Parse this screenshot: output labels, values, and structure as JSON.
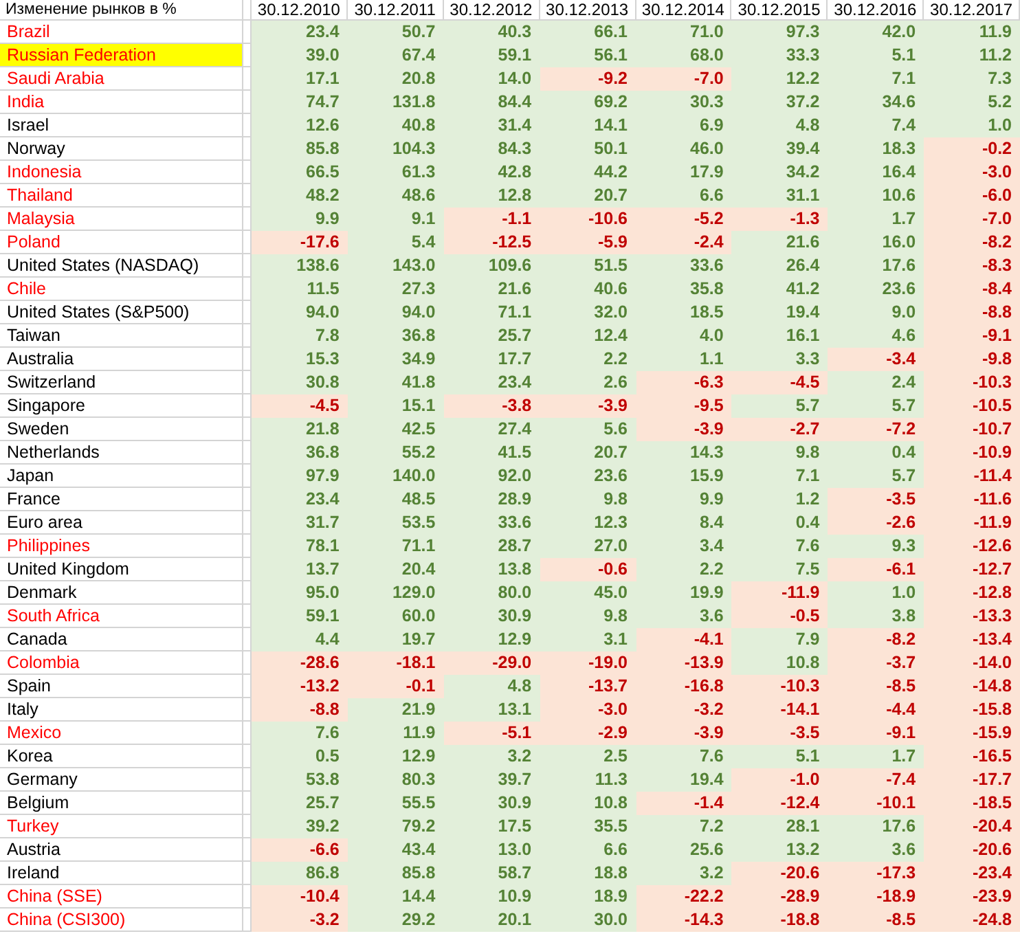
{
  "table": {
    "title": "Изменение рынков в %",
    "columns": [
      "30.12.2010",
      "30.12.2011",
      "30.12.2012",
      "30.12.2013",
      "30.12.2014",
      "30.12.2015",
      "30.12.2016",
      "30.12.2017"
    ],
    "rows": [
      {
        "name": "Brazil",
        "color": "#ff0000",
        "highlighted": false,
        "values": [
          "23.4",
          "50.7",
          "40.3",
          "66.1",
          "71.0",
          "97.3",
          "42.0",
          "11.9"
        ]
      },
      {
        "name": "Russian Federation",
        "color": "#ff0000",
        "highlighted": true,
        "values": [
          "39.0",
          "67.4",
          "59.1",
          "56.1",
          "68.0",
          "33.3",
          "5.1",
          "11.2"
        ]
      },
      {
        "name": "Saudi Arabia",
        "color": "#ff0000",
        "highlighted": false,
        "values": [
          "17.1",
          "20.8",
          "14.0",
          "-9.2",
          "-7.0",
          "12.2",
          "7.1",
          "7.3"
        ]
      },
      {
        "name": "India",
        "color": "#ff0000",
        "highlighted": false,
        "values": [
          "74.7",
          "131.8",
          "84.4",
          "69.2",
          "30.3",
          "37.2",
          "34.6",
          "5.2"
        ]
      },
      {
        "name": "Israel",
        "color": "#000000",
        "highlighted": false,
        "values": [
          "12.6",
          "40.8",
          "31.4",
          "14.1",
          "6.9",
          "4.8",
          "7.4",
          "1.0"
        ]
      },
      {
        "name": "Norway",
        "color": "#000000",
        "highlighted": false,
        "values": [
          "85.8",
          "104.3",
          "84.3",
          "50.1",
          "46.0",
          "39.4",
          "18.3",
          "-0.2"
        ]
      },
      {
        "name": "Indonesia",
        "color": "#ff0000",
        "highlighted": false,
        "values": [
          "66.5",
          "61.3",
          "42.8",
          "44.2",
          "17.9",
          "34.2",
          "16.4",
          "-3.0"
        ]
      },
      {
        "name": "Thailand",
        "color": "#ff0000",
        "highlighted": false,
        "values": [
          "48.2",
          "48.6",
          "12.8",
          "20.7",
          "6.6",
          "31.1",
          "10.6",
          "-6.0"
        ]
      },
      {
        "name": "Malaysia",
        "color": "#ff0000",
        "highlighted": false,
        "values": [
          "9.9",
          "9.1",
          "-1.1",
          "-10.6",
          "-5.2",
          "-1.3",
          "1.7",
          "-7.0"
        ]
      },
      {
        "name": "Poland",
        "color": "#ff0000",
        "highlighted": false,
        "values": [
          "-17.6",
          "5.4",
          "-12.5",
          "-5.9",
          "-2.4",
          "21.6",
          "16.0",
          "-8.2"
        ]
      },
      {
        "name": "United States (NASDAQ)",
        "color": "#000000",
        "highlighted": false,
        "values": [
          "138.6",
          "143.0",
          "109.6",
          "51.5",
          "33.6",
          "26.4",
          "17.6",
          "-8.3"
        ]
      },
      {
        "name": "Chile",
        "color": "#ff0000",
        "highlighted": false,
        "values": [
          "11.5",
          "27.3",
          "21.6",
          "40.6",
          "35.8",
          "41.2",
          "23.6",
          "-8.4"
        ]
      },
      {
        "name": "United States (S&P500)",
        "color": "#000000",
        "highlighted": false,
        "values": [
          "94.0",
          "94.0",
          "71.1",
          "32.0",
          "18.5",
          "19.4",
          "9.0",
          "-8.8"
        ]
      },
      {
        "name": "Taiwan",
        "color": "#000000",
        "highlighted": false,
        "values": [
          "7.8",
          "36.8",
          "25.7",
          "12.4",
          "4.0",
          "16.1",
          "4.6",
          "-9.1"
        ]
      },
      {
        "name": "Australia",
        "color": "#000000",
        "highlighted": false,
        "values": [
          "15.3",
          "34.9",
          "17.7",
          "2.2",
          "1.1",
          "3.3",
          "-3.4",
          "-9.8"
        ]
      },
      {
        "name": "Switzerland",
        "color": "#000000",
        "highlighted": false,
        "values": [
          "30.8",
          "41.8",
          "23.4",
          "2.6",
          "-6.3",
          "-4.5",
          "2.4",
          "-10.3"
        ]
      },
      {
        "name": "Singapore",
        "color": "#000000",
        "highlighted": false,
        "values": [
          "-4.5",
          "15.1",
          "-3.8",
          "-3.9",
          "-9.5",
          "5.7",
          "5.7",
          "-10.5"
        ]
      },
      {
        "name": "Sweden",
        "color": "#000000",
        "highlighted": false,
        "values": [
          "21.8",
          "42.5",
          "27.4",
          "5.6",
          "-3.9",
          "-2.7",
          "-7.2",
          "-10.7"
        ]
      },
      {
        "name": "Netherlands",
        "color": "#000000",
        "highlighted": false,
        "values": [
          "36.8",
          "55.2",
          "41.5",
          "20.7",
          "14.3",
          "9.8",
          "0.4",
          "-10.9"
        ]
      },
      {
        "name": "Japan",
        "color": "#000000",
        "highlighted": false,
        "values": [
          "97.9",
          "140.0",
          "92.0",
          "23.6",
          "15.9",
          "7.1",
          "5.7",
          "-11.4"
        ]
      },
      {
        "name": "France",
        "color": "#000000",
        "highlighted": false,
        "values": [
          "23.4",
          "48.5",
          "28.9",
          "9.8",
          "9.9",
          "1.2",
          "-3.5",
          "-11.6"
        ]
      },
      {
        "name": "Euro area",
        "color": "#000000",
        "highlighted": false,
        "values": [
          "31.7",
          "53.5",
          "33.6",
          "12.3",
          "8.4",
          "0.4",
          "-2.6",
          "-11.9"
        ]
      },
      {
        "name": "Philippines",
        "color": "#ff0000",
        "highlighted": false,
        "values": [
          "78.1",
          "71.1",
          "28.7",
          "27.0",
          "3.4",
          "7.6",
          "9.3",
          "-12.6"
        ]
      },
      {
        "name": "United Kingdom",
        "color": "#000000",
        "highlighted": false,
        "values": [
          "13.7",
          "20.4",
          "13.8",
          "-0.6",
          "2.2",
          "7.5",
          "-6.1",
          "-12.7"
        ]
      },
      {
        "name": "Denmark",
        "color": "#000000",
        "highlighted": false,
        "values": [
          "95.0",
          "129.0",
          "80.0",
          "45.0",
          "19.9",
          "-11.9",
          "1.0",
          "-12.8"
        ]
      },
      {
        "name": "South Africa",
        "color": "#ff0000",
        "highlighted": false,
        "values": [
          "59.1",
          "60.0",
          "30.9",
          "9.8",
          "3.6",
          "-0.5",
          "3.8",
          "-13.3"
        ]
      },
      {
        "name": "Canada",
        "color": "#000000",
        "highlighted": false,
        "values": [
          "4.4",
          "19.7",
          "12.9",
          "3.1",
          "-4.1",
          "7.9",
          "-8.2",
          "-13.4"
        ]
      },
      {
        "name": "Colombia",
        "color": "#ff0000",
        "highlighted": false,
        "values": [
          "-28.6",
          "-18.1",
          "-29.0",
          "-19.0",
          "-13.9",
          "10.8",
          "-3.7",
          "-14.0"
        ]
      },
      {
        "name": "Spain",
        "color": "#000000",
        "highlighted": false,
        "values": [
          "-13.2",
          "-0.1",
          "4.8",
          "-13.7",
          "-16.8",
          "-10.3",
          "-8.5",
          "-14.8"
        ]
      },
      {
        "name": "Italy",
        "color": "#000000",
        "highlighted": false,
        "values": [
          "-8.8",
          "21.9",
          "13.1",
          "-3.0",
          "-3.2",
          "-14.1",
          "-4.4",
          "-15.8"
        ]
      },
      {
        "name": "Mexico",
        "color": "#ff0000",
        "highlighted": false,
        "values": [
          "7.6",
          "11.9",
          "-5.1",
          "-2.9",
          "-3.9",
          "-3.5",
          "-9.1",
          "-15.9"
        ]
      },
      {
        "name": "Korea",
        "color": "#000000",
        "highlighted": false,
        "values": [
          "0.5",
          "12.9",
          "3.2",
          "2.5",
          "7.6",
          "5.1",
          "1.7",
          "-16.5"
        ]
      },
      {
        "name": "Germany",
        "color": "#000000",
        "highlighted": false,
        "values": [
          "53.8",
          "80.3",
          "39.7",
          "11.3",
          "19.4",
          "-1.0",
          "-7.4",
          "-17.7"
        ]
      },
      {
        "name": "Belgium",
        "color": "#000000",
        "highlighted": false,
        "values": [
          "25.7",
          "55.5",
          "30.9",
          "10.8",
          "-1.4",
          "-12.4",
          "-10.1",
          "-18.5"
        ]
      },
      {
        "name": "Turkey",
        "color": "#ff0000",
        "highlighted": false,
        "values": [
          "39.2",
          "79.2",
          "17.5",
          "35.5",
          "7.2",
          "28.1",
          "17.6",
          "-20.4"
        ]
      },
      {
        "name": "Austria",
        "color": "#000000",
        "highlighted": false,
        "values": [
          "-6.6",
          "43.4",
          "13.0",
          "6.6",
          "25.6",
          "13.2",
          "3.6",
          "-20.6"
        ]
      },
      {
        "name": "Ireland",
        "color": "#000000",
        "highlighted": false,
        "values": [
          "86.8",
          "85.8",
          "58.7",
          "18.8",
          "3.2",
          "-20.6",
          "-17.3",
          "-23.4"
        ]
      },
      {
        "name": "China (SSE)",
        "color": "#ff0000",
        "highlighted": false,
        "values": [
          "-10.4",
          "14.4",
          "10.9",
          "18.9",
          "-22.2",
          "-28.9",
          "-18.9",
          "-23.9"
        ]
      },
      {
        "name": "China (CSI300)",
        "color": "#ff0000",
        "highlighted": false,
        "values": [
          "-3.2",
          "29.2",
          "20.1",
          "30.0",
          "-14.3",
          "-18.8",
          "-8.5",
          "-24.8"
        ]
      }
    ]
  }
}
